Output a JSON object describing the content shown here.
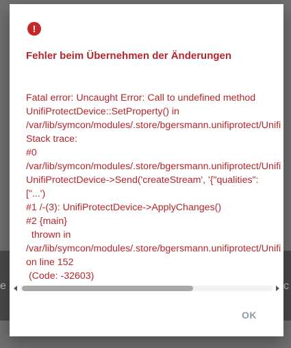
{
  "background": {
    "left_text": "e",
    "right_text": "c"
  },
  "dialog": {
    "icon": "error-icon",
    "icon_glyph": "!",
    "title": "Fehler beim Übernehmen der Änderungen",
    "message_lines": [
      "Fatal error: Uncaught Error: Call to undefined method",
      "UnifiProtectDevice::SetProperty() in",
      "/var/lib/symcon/modules/.store/bgersmann.unifiprotect/Unifi",
      "Stack trace:",
      "#0",
      "/var/lib/symcon/modules/.store/bgersmann.unifiprotect/Unifi",
      "UnifiProtectDevice->Send('createStream', '{\"qualities\":",
      "[\"...')",
      "#1 /-(3): UnifiProtectDevice->ApplyChanges()",
      "#2 {main}",
      "  thrown in",
      "/var/lib/symcon/modules/.store/bgersmann.unifiprotect/Unifi",
      "on line 152",
      " (Code: -32603)"
    ],
    "ok_label": "OK"
  },
  "colors": {
    "error_red": "#b3262b",
    "icon_red": "#c62828",
    "button_text": "#8a9aa6"
  }
}
